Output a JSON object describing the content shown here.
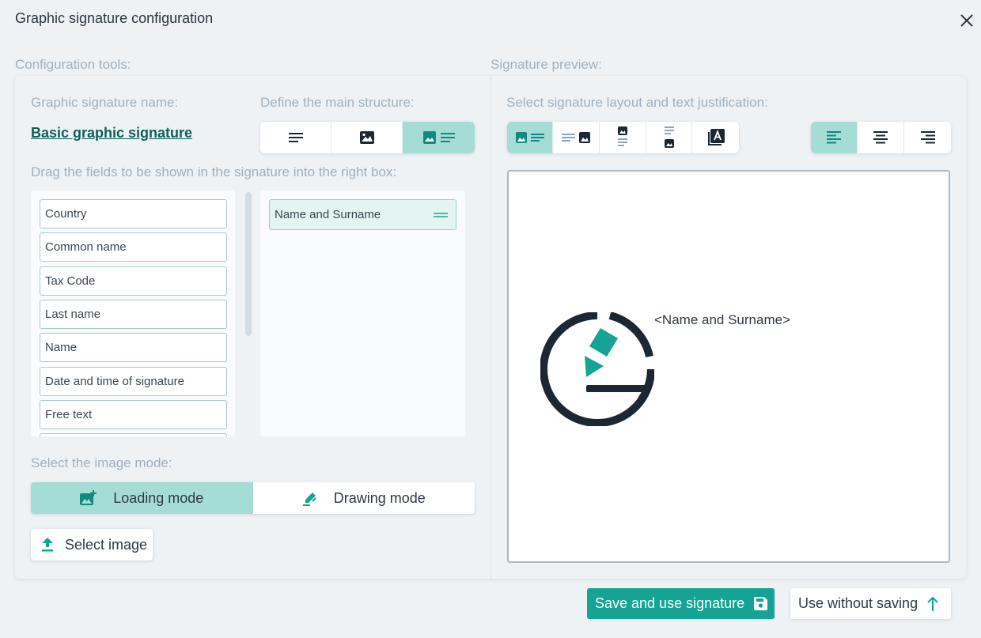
{
  "dialog": {
    "title": "Graphic signature configuration"
  },
  "left": {
    "section_label": "Configuration tools:",
    "name_label": "Graphic signature name:",
    "name_value": "Basic graphic signature",
    "structure_label": "Define the main structure:",
    "structure_options": [
      {
        "icon": "text-lines-icon",
        "active": false
      },
      {
        "icon": "image-icon",
        "active": false
      },
      {
        "icon": "image-and-text-icon",
        "active": true
      }
    ],
    "drag_label": "Drag the fields to be shown in the signature into the right box:",
    "available_fields": [
      "Country",
      "Common name",
      "Tax Code",
      "Last name",
      "Name",
      "Date and time of signature",
      "Free text"
    ],
    "selected_fields": [
      "Name and Surname"
    ],
    "image_mode_label": "Select the image mode:",
    "image_modes": [
      {
        "label": "Loading mode",
        "icon": "add-image-icon",
        "active": true
      },
      {
        "label": "Drawing mode",
        "icon": "draw-icon",
        "active": false
      }
    ],
    "select_image_label": "Select image"
  },
  "right": {
    "section_label": "Signature preview:",
    "layout_label": "Select signature layout and text justification:",
    "layout_options": [
      {
        "icon": "image-left-text-right-icon",
        "active": true
      },
      {
        "icon": "text-left-image-right-icon",
        "active": false
      },
      {
        "icon": "image-top-text-bottom-icon",
        "active": false
      },
      {
        "icon": "text-top-image-bottom-icon",
        "active": false
      },
      {
        "icon": "text-over-image-icon",
        "active": false
      }
    ],
    "justify_options": [
      {
        "icon": "align-left-icon",
        "active": true
      },
      {
        "icon": "align-center-icon",
        "active": false
      },
      {
        "icon": "align-right-icon",
        "active": false
      }
    ],
    "preview_text": "<Name and Surname>",
    "preview_logo_icon": "signature-logo-icon"
  },
  "footer": {
    "save_label": "Save and use signature",
    "nosave_label": "Use without saving"
  },
  "colors": {
    "accent": "#14a394",
    "active_segment": "#a6dcd6",
    "link": "#0f5f57",
    "dark": "#1c2733"
  }
}
